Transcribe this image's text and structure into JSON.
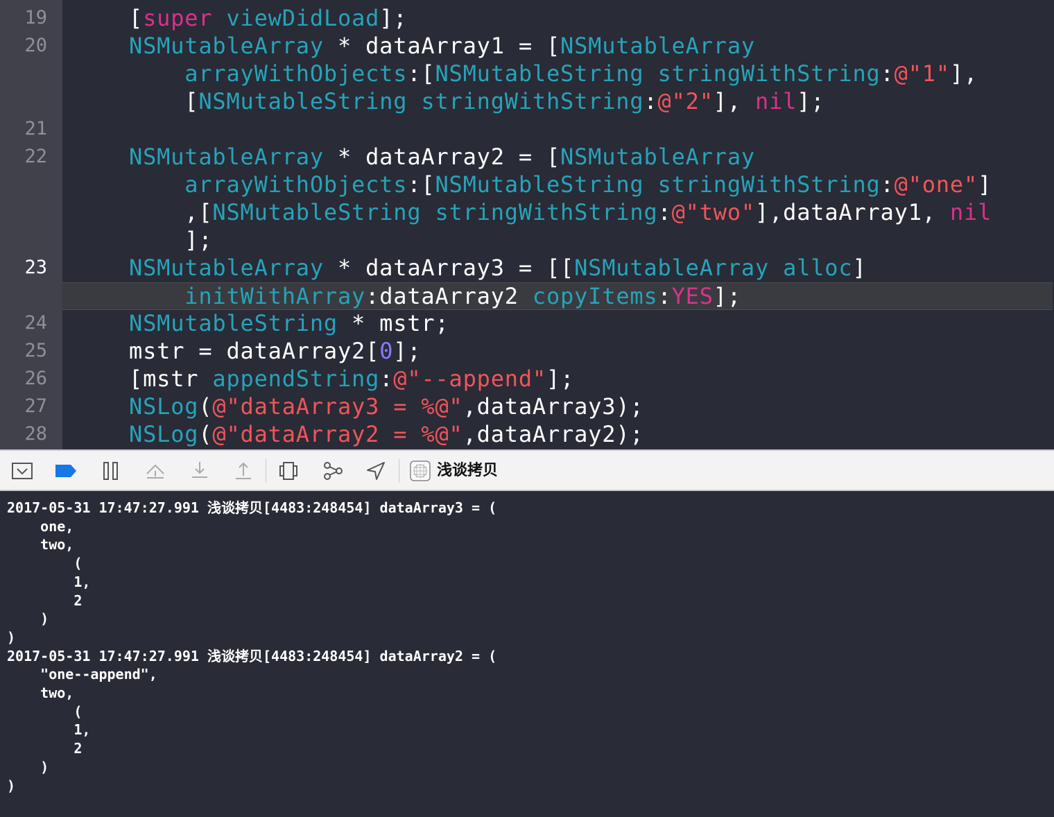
{
  "editor": {
    "lines": [
      {
        "num": "19",
        "active": false,
        "current": false,
        "tokens": [
          [
            "w",
            "["
          ],
          [
            "k",
            "super"
          ],
          [
            "w",
            " "
          ],
          [
            "m",
            "viewDidLoad"
          ],
          [
            "w",
            "];"
          ]
        ]
      },
      {
        "num": "20",
        "active": false,
        "current": false,
        "tokens": [
          [
            "t",
            "NSMutableArray"
          ],
          [
            "w",
            " * dataArray1 = ["
          ],
          [
            "t",
            "NSMutableArray"
          ]
        ]
      },
      {
        "num": "",
        "active": false,
        "current": false,
        "tokens": [
          [
            "w",
            "    "
          ],
          [
            "m",
            "arrayWithObjects"
          ],
          [
            "w",
            ":["
          ],
          [
            "t",
            "NSMutableString"
          ],
          [
            "w",
            " "
          ],
          [
            "m",
            "stringWithString"
          ],
          [
            "w",
            ":"
          ],
          [
            "s",
            "@\"1\""
          ],
          [
            "w",
            "],"
          ]
        ]
      },
      {
        "num": "",
        "active": false,
        "current": false,
        "tokens": [
          [
            "w",
            "    ["
          ],
          [
            "t",
            "NSMutableString"
          ],
          [
            "w",
            " "
          ],
          [
            "m",
            "stringWithString"
          ],
          [
            "w",
            ":"
          ],
          [
            "s",
            "@\"2\""
          ],
          [
            "w",
            "], "
          ],
          [
            "k",
            "nil"
          ],
          [
            "w",
            "];"
          ]
        ]
      },
      {
        "num": "21",
        "active": false,
        "current": false,
        "tokens": []
      },
      {
        "num": "22",
        "active": false,
        "current": false,
        "tokens": [
          [
            "t",
            "NSMutableArray"
          ],
          [
            "w",
            " * dataArray2 = ["
          ],
          [
            "t",
            "NSMutableArray"
          ]
        ]
      },
      {
        "num": "",
        "active": false,
        "current": false,
        "tokens": [
          [
            "w",
            "    "
          ],
          [
            "m",
            "arrayWithObjects"
          ],
          [
            "w",
            ":["
          ],
          [
            "t",
            "NSMutableString"
          ],
          [
            "w",
            " "
          ],
          [
            "m",
            "stringWithString"
          ],
          [
            "w",
            ":"
          ],
          [
            "s",
            "@\"one\""
          ],
          [
            "w",
            "]"
          ]
        ]
      },
      {
        "num": "",
        "active": false,
        "current": false,
        "tokens": [
          [
            "w",
            "    ,["
          ],
          [
            "t",
            "NSMutableString"
          ],
          [
            "w",
            " "
          ],
          [
            "m",
            "stringWithString"
          ],
          [
            "w",
            ":"
          ],
          [
            "s",
            "@\"two\""
          ],
          [
            "w",
            "],dataArray1, "
          ],
          [
            "k",
            "nil"
          ]
        ]
      },
      {
        "num": "",
        "active": false,
        "current": false,
        "tokens": [
          [
            "w",
            "    ];"
          ]
        ]
      },
      {
        "num": "23",
        "active": true,
        "current": false,
        "tokens": [
          [
            "t",
            "NSMutableArray"
          ],
          [
            "w",
            " * dataArray3 = [["
          ],
          [
            "t",
            "NSMutableArray"
          ],
          [
            "w",
            " "
          ],
          [
            "m",
            "alloc"
          ],
          [
            "w",
            "]"
          ]
        ]
      },
      {
        "num": "",
        "active": false,
        "current": true,
        "tokens": [
          [
            "w",
            "    "
          ],
          [
            "m",
            "initWithArray"
          ],
          [
            "w",
            ":dataArray2 "
          ],
          [
            "m",
            "copyItems"
          ],
          [
            "w",
            ":"
          ],
          [
            "k",
            "YES"
          ],
          [
            "w",
            "];"
          ]
        ]
      },
      {
        "num": "24",
        "active": false,
        "current": false,
        "tokens": [
          [
            "t",
            "NSMutableString"
          ],
          [
            "w",
            " * mstr;"
          ]
        ]
      },
      {
        "num": "25",
        "active": false,
        "current": false,
        "tokens": [
          [
            "w",
            "mstr = dataArray2["
          ],
          [
            "n",
            "0"
          ],
          [
            "w",
            "];"
          ]
        ]
      },
      {
        "num": "26",
        "active": false,
        "current": false,
        "tokens": [
          [
            "w",
            "[mstr "
          ],
          [
            "m",
            "appendString"
          ],
          [
            "w",
            ":"
          ],
          [
            "s",
            "@\"--append\""
          ],
          [
            "w",
            "];"
          ]
        ]
      },
      {
        "num": "27",
        "active": false,
        "current": false,
        "tokens": [
          [
            "t",
            "NSLog"
          ],
          [
            "w",
            "("
          ],
          [
            "s",
            "@\"dataArray3 = %@\""
          ],
          [
            "w",
            ",dataArray3);"
          ]
        ]
      },
      {
        "num": "28",
        "active": false,
        "current": false,
        "tokens": [
          [
            "t",
            "NSLog"
          ],
          [
            "w",
            "("
          ],
          [
            "s",
            "@\"dataArray2 = %@\""
          ],
          [
            "w",
            ",dataArray2);"
          ]
        ]
      }
    ]
  },
  "toolbar": {
    "target_label": "浅谈拷贝",
    "icons": [
      "hide-debug-area-icon",
      "breakpoints-toggle-icon",
      "pause-icon",
      "step-over-icon",
      "step-into-icon",
      "step-out-icon",
      "view-debugger-icon",
      "memory-graph-icon",
      "simulate-location-icon",
      "target-app-icon"
    ]
  },
  "console": {
    "text": "2017-05-31 17:47:27.991 浅谈拷贝[4483:248454] dataArray3 = (\n    one,\n    two,\n        (\n        1,\n        2\n    )\n)\n2017-05-31 17:47:27.991 浅谈拷贝[4483:248454] dataArray2 = (\n    \"one--append\",\n    two,\n        (\n        1,\n        2\n    )\n)"
  },
  "colors": {
    "editor_bg": "#292b36",
    "gutter_bg": "#40414b",
    "keyword": "#d9328a",
    "type": "#27a3bb",
    "string": "#f2545b",
    "number": "#8a79ff",
    "toolbar_bg": "#f3f3f3",
    "breakpoint_blue": "#1677e6"
  }
}
